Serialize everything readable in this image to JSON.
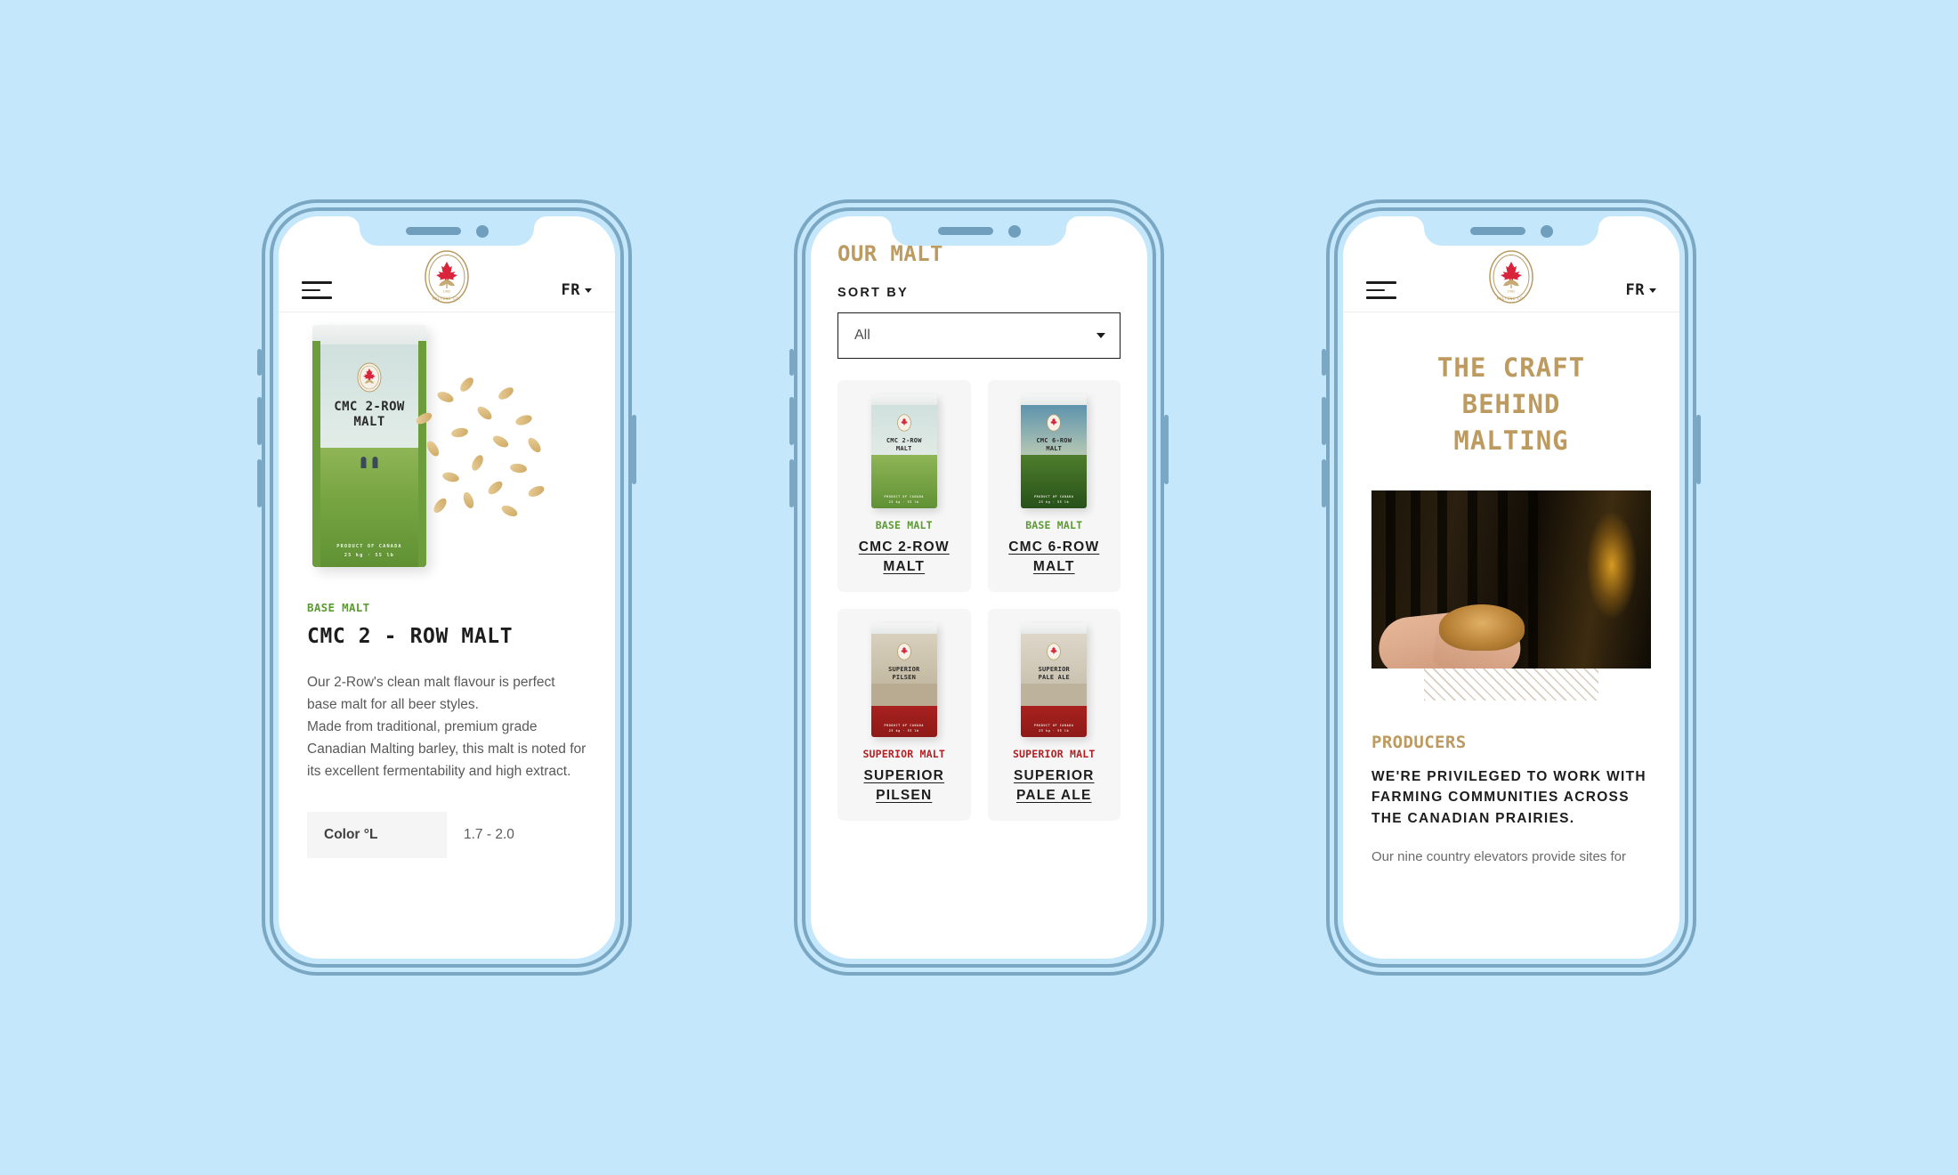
{
  "brand": {
    "logo_name": "canada-malting-co-crest",
    "crest_lines": [
      "MALTING CO.",
      "LIMITED"
    ],
    "crest_year": "1902",
    "accent_gold": "#bd9a5f",
    "accent_green": "#5c9a33",
    "accent_red": "#b31f23",
    "page_background": "#c5e7fb",
    "frame_color": "#7aa8c4"
  },
  "header": {
    "menu_label": "menu",
    "language": "FR"
  },
  "phone1": {
    "screen_name": "product-detail",
    "product": {
      "category": "BASE MALT",
      "title": "CMC 2 - ROW MALT",
      "description": "Our 2-Row's clean malt flavour is perfect base malt for all beer styles.\nMade from traditional, premium grade Canadian Malting barley, this malt is noted for its excellent fermentability and high extract.",
      "bag_title": "CMC 2-ROW\nMALT",
      "bag_origin": "PRODUCT OF CANADA",
      "bag_weight": "25 kg · 55 lb"
    },
    "spec": {
      "key": "Color °L",
      "value": "1.7 - 2.0"
    }
  },
  "phone2": {
    "screen_name": "product-listing",
    "page_title": "OUR MALT",
    "sort_label": "SORT BY",
    "sort_value": "All",
    "products": [
      {
        "category": "BASE MALT",
        "category_kind": "base",
        "name": "CMC 2-ROW MALT",
        "bag_title": "CMC 2-ROW\nMALT",
        "bag_origin": "PRODUCT OF CANADA",
        "bag_weight": "25 kg · 55 lb",
        "sky": "#cfe0dd",
        "body": "#6d9c3c"
      },
      {
        "category": "BASE MALT",
        "category_kind": "base",
        "name": "CMC 6-ROW MALT",
        "bag_title": "CMC 6-ROW\nMALT",
        "bag_origin": "PRODUCT OF CANADA",
        "bag_weight": "25 kg · 55 lb",
        "sky": "#6d9cb4",
        "body": "#35601f"
      },
      {
        "category": "SUPERIOR MALT",
        "category_kind": "superior",
        "name": "SUPERIOR PILSEN",
        "bag_title": "SUPERIOR\nPILSEN",
        "bag_origin": "PRODUCT OF CANADA",
        "bag_weight": "25 kg · 55 lb",
        "sky": "#cdc4b2",
        "body": "#a8211f"
      },
      {
        "category": "SUPERIOR MALT",
        "category_kind": "superior",
        "name": "SUPERIOR PALE ALE",
        "bag_title": "SUPERIOR\nPALE ALE",
        "bag_origin": "PRODUCT OF CANADA",
        "bag_weight": "25 kg · 55 lb",
        "sky": "#d5cec0",
        "body": "#a8211f"
      }
    ]
  },
  "phone3": {
    "screen_name": "craft-behind-malting",
    "hero_title": "THE CRAFT\nBEHIND\nMALTING",
    "photo_alt": "hands-holding-malted-barley",
    "section_title": "PRODUCERS",
    "section_lead": "WE'RE PRIVILEGED TO WORK WITH FARMING COMMUNITIES ACROSS THE CANADIAN PRAIRIES.",
    "section_body": "Our nine country elevators provide sites for"
  }
}
